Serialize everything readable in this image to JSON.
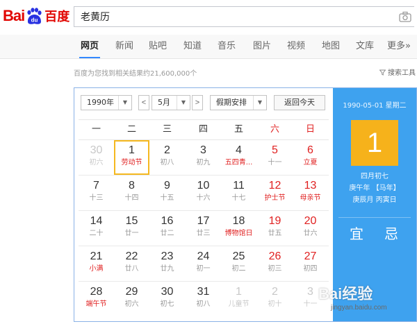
{
  "header": {
    "logo_latin": "Bai",
    "logo_du": "du",
    "logo_cn": "百度",
    "search_value": "老黄历"
  },
  "nav": {
    "tabs": [
      {
        "label": "网页",
        "active": true
      },
      {
        "label": "新闻"
      },
      {
        "label": "贴吧"
      },
      {
        "label": "知道"
      },
      {
        "label": "音乐"
      },
      {
        "label": "图片"
      },
      {
        "label": "视频"
      },
      {
        "label": "地图"
      },
      {
        "label": "文库"
      },
      {
        "label": "更多»"
      }
    ]
  },
  "results": {
    "count_text": "百度为您找到相关结果约21,600,000个",
    "tools_label": "搜索工具"
  },
  "calendar": {
    "year_select": "1990年",
    "month_select": "5月",
    "prev_label": "<",
    "next_label": ">",
    "holiday_select": "假期安排",
    "today_button": "返回今天",
    "weekdays": [
      "一",
      "二",
      "三",
      "四",
      "五",
      "六",
      "日"
    ],
    "weeks": [
      [
        {
          "day": "30",
          "lunar": "初六",
          "other": true
        },
        {
          "day": "1",
          "lunar": "劳动节",
          "festival": true,
          "selected": true
        },
        {
          "day": "2",
          "lunar": "初八"
        },
        {
          "day": "3",
          "lunar": "初九"
        },
        {
          "day": "4",
          "lunar": "五四青...",
          "festival": true
        },
        {
          "day": "5",
          "lunar": "十一"
        },
        {
          "day": "6",
          "lunar": "立夏",
          "festival": true
        }
      ],
      [
        {
          "day": "7",
          "lunar": "十三"
        },
        {
          "day": "8",
          "lunar": "十四"
        },
        {
          "day": "9",
          "lunar": "十五"
        },
        {
          "day": "10",
          "lunar": "十六"
        },
        {
          "day": "11",
          "lunar": "十七"
        },
        {
          "day": "12",
          "lunar": "护士节",
          "festival": true
        },
        {
          "day": "13",
          "lunar": "母亲节",
          "festival": true
        }
      ],
      [
        {
          "day": "14",
          "lunar": "二十"
        },
        {
          "day": "15",
          "lunar": "廿一"
        },
        {
          "day": "16",
          "lunar": "廿二"
        },
        {
          "day": "17",
          "lunar": "廿三"
        },
        {
          "day": "18",
          "lunar": "博物馆日",
          "festival": true
        },
        {
          "day": "19",
          "lunar": "廿五"
        },
        {
          "day": "20",
          "lunar": "廿六"
        }
      ],
      [
        {
          "day": "21",
          "lunar": "小满",
          "festival": true
        },
        {
          "day": "22",
          "lunar": "廿八"
        },
        {
          "day": "23",
          "lunar": "廿九"
        },
        {
          "day": "24",
          "lunar": "初一"
        },
        {
          "day": "25",
          "lunar": "初二"
        },
        {
          "day": "26",
          "lunar": "初三"
        },
        {
          "day": "27",
          "lunar": "初四"
        }
      ],
      [
        {
          "day": "28",
          "lunar": "端午节",
          "festival": true
        },
        {
          "day": "29",
          "lunar": "初六"
        },
        {
          "day": "30",
          "lunar": "初七"
        },
        {
          "day": "31",
          "lunar": "初八"
        },
        {
          "day": "1",
          "lunar": "儿童节",
          "other": true
        },
        {
          "day": "2",
          "lunar": "初十",
          "other": true
        },
        {
          "day": "3",
          "lunar": "十一",
          "other": true
        }
      ]
    ],
    "side": {
      "date_line": "1990-05-01 星期二",
      "big_day": "1",
      "lunar_lines": [
        "四月初七",
        "庚午年 【马年】",
        "庚辰月 丙寅日"
      ],
      "yi": "宜",
      "ji": "忌"
    }
  },
  "watermark": {
    "brand_text": "Bai经验",
    "url": "jingyan.baidu.com"
  },
  "colors": {
    "brand_red": "#e10602",
    "panel_blue": "#3ea2ef",
    "highlight_orange": "#f6b21b",
    "weekend_red": "#e02020"
  }
}
